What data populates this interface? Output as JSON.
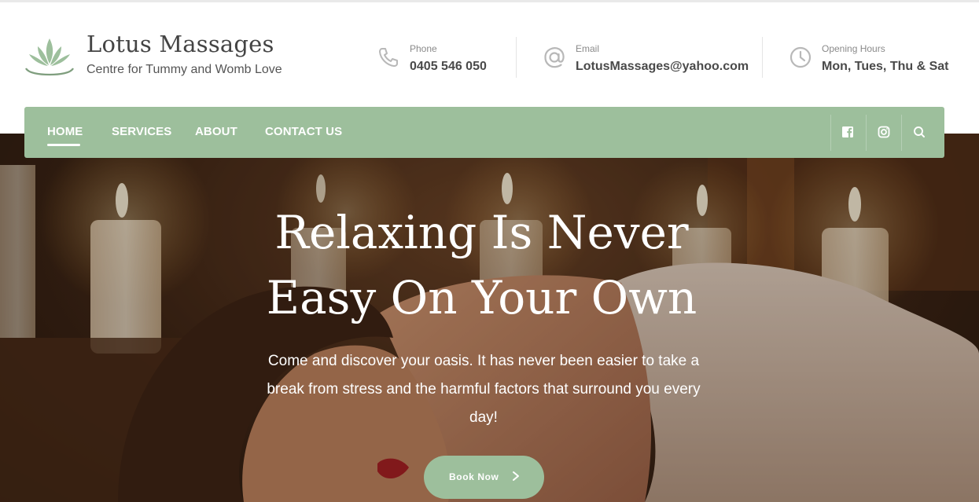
{
  "brand": {
    "title": "Lotus Massages",
    "tagline": "Centre for Tummy and Womb Love",
    "logo_icon": "lotus-icon",
    "accent": "#9dbf9c"
  },
  "contact": {
    "phone": {
      "label": "Phone",
      "value": "0405 546 050",
      "icon": "phone-icon"
    },
    "email": {
      "label": "Email",
      "value": "LotusMassages@yahoo.com",
      "icon": "at-icon"
    },
    "hours": {
      "label": "Opening Hours",
      "value": "Mon, Tues, Thu & Sat",
      "icon": "clock-icon"
    }
  },
  "nav": {
    "items": [
      "HOME",
      "SERVICES",
      "ABOUT",
      "CONTACT US"
    ],
    "active": "HOME",
    "icons": [
      "facebook-icon",
      "instagram-icon",
      "search-icon"
    ]
  },
  "hero": {
    "headline_line1": "Relaxing Is Never",
    "headline_line2": "Easy On Your Own",
    "subtext": "Come and discover your oasis. It has never been easier to take a break from stress and the harmful factors that surround you every day!",
    "button_label": "Book Now"
  }
}
